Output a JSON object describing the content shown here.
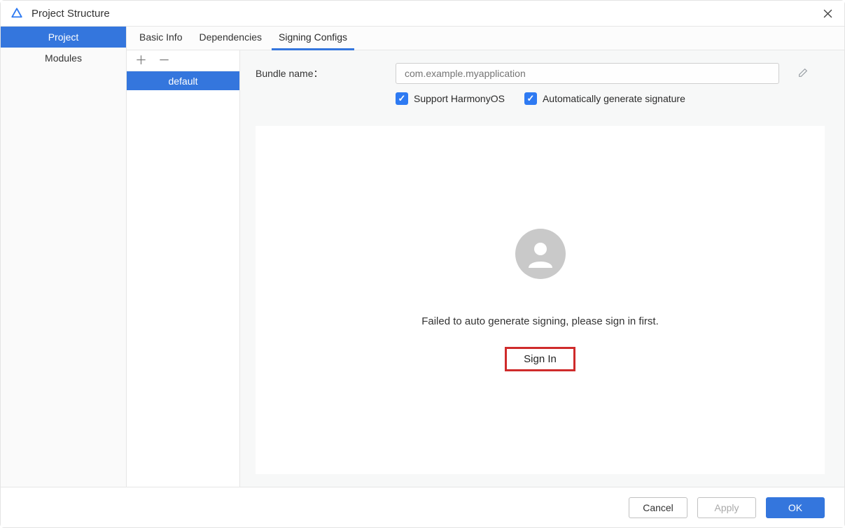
{
  "window": {
    "title": "Project Structure"
  },
  "sidebar": {
    "items": [
      {
        "label": "Project",
        "active": true
      },
      {
        "label": "Modules",
        "active": false
      }
    ]
  },
  "tabs": [
    {
      "label": "Basic Info",
      "active": false
    },
    {
      "label": "Dependencies",
      "active": false
    },
    {
      "label": "Signing Configs",
      "active": true
    }
  ],
  "configs": {
    "items": [
      {
        "label": "default",
        "active": true
      }
    ]
  },
  "form": {
    "bundle_label": "Bundle name：",
    "bundle_placeholder": "com.example.myapplication",
    "support_label": "Support HarmonyOS",
    "autosign_label": "Automatically generate signature"
  },
  "signin": {
    "message": "Failed to auto generate signing, please sign in first.",
    "button": "Sign In"
  },
  "footer": {
    "cancel": "Cancel",
    "apply": "Apply",
    "ok": "OK"
  }
}
